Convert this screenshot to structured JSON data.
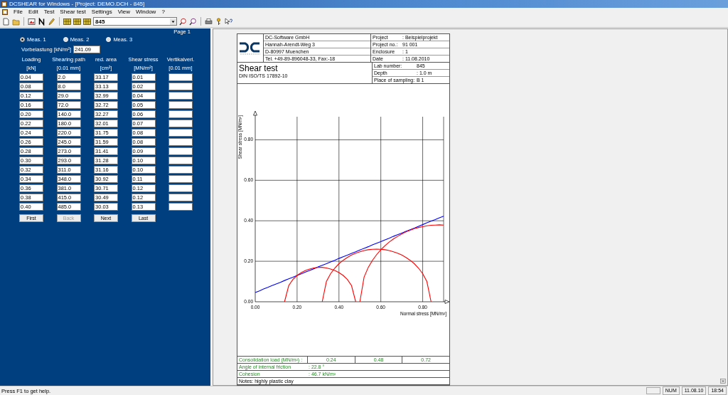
{
  "window": {
    "title": "DCSHEAR for Windows - [Project: DEMO.DCH - 845]"
  },
  "menu": [
    "File",
    "Edit",
    "Test",
    "Shear test",
    "Settings",
    "View",
    "Window",
    "?"
  ],
  "toolbar": {
    "combo_value": "845"
  },
  "input_panel": {
    "page": "Page 1",
    "measurements": [
      {
        "label": "Meas. 1",
        "selected": true
      },
      {
        "label": "Meas. 2",
        "selected": false
      },
      {
        "label": "Meas. 3",
        "selected": false
      }
    ],
    "preload": {
      "label": "Vorbelastung [kN/m²]",
      "value": "241.09"
    },
    "columns": [
      {
        "title": "Loading",
        "unit": "[kN]"
      },
      {
        "title": "Shearing path",
        "unit": "[0.01 mm]"
      },
      {
        "title": "red. area",
        "unit": "[cm²]"
      },
      {
        "title": "Shear stress",
        "unit": "[MN/m²]"
      },
      {
        "title": "Vertikalverl.",
        "unit": "[0.01 mm]"
      }
    ],
    "rows": [
      [
        "0.04",
        "2.0",
        "33.17",
        "0.01"
      ],
      [
        "0.08",
        "8.0",
        "33.13",
        "0.02"
      ],
      [
        "0.12",
        "29.0",
        "32.99",
        "0.04"
      ],
      [
        "0.16",
        "72.0",
        "32.72",
        "0.05"
      ],
      [
        "0.20",
        "140.0",
        "32.27",
        "0.06"
      ],
      [
        "0.22",
        "180.0",
        "32.01",
        "0.07"
      ],
      [
        "0.24",
        "220.0",
        "31.75",
        "0.08"
      ],
      [
        "0.26",
        "245.0",
        "31.59",
        "0.08"
      ],
      [
        "0.28",
        "273.0",
        "31.41",
        "0.09"
      ],
      [
        "0.30",
        "293.0",
        "31.28",
        "0.10"
      ],
      [
        "0.32",
        "311.0",
        "31.16",
        "0.10"
      ],
      [
        "0.34",
        "348.0",
        "30.92",
        "0.11"
      ],
      [
        "0.36",
        "381.0",
        "30.71",
        "0.12"
      ],
      [
        "0.38",
        "415.0",
        "30.49",
        "0.12"
      ],
      [
        "0.40",
        "485.0",
        "30.03",
        "0.13"
      ]
    ],
    "buttons": [
      {
        "label": "First",
        "disabled": false
      },
      {
        "label": "Back",
        "disabled": true
      },
      {
        "label": "Next",
        "disabled": false
      },
      {
        "label": "Last",
        "disabled": false
      }
    ]
  },
  "report": {
    "company": [
      "DC-Software GmbH",
      "Hannah-Arendt-Weg 3",
      "D-80997 Muenchen",
      "Tel. +49-89-896048-33, Fax:-18"
    ],
    "project": [
      {
        "label": "Project",
        "value": ": Beispielprojekt"
      },
      {
        "label": "Project no.:",
        "value": "91 001"
      },
      {
        "label": "Enclosure",
        "value": ": 1"
      },
      {
        "label": "Date",
        "value": ": 11.08.2010"
      }
    ],
    "title": "Shear test",
    "standard": "DIN ISO/TS 17892-10",
    "sample": [
      {
        "label": "Lab number:",
        "value": "845"
      },
      {
        "label": "Depth",
        "value": ": 1.0 m"
      },
      {
        "label": "Place of sampling:",
        "value": "B 1"
      }
    ],
    "chart_data": {
      "type": "line",
      "xlabel": "Normal stress [MN/m²]",
      "ylabel": "Shear stress [MN/m²]",
      "grid": true,
      "x": [
        0,
        0.02,
        0.04,
        0.06,
        0.08,
        0.1,
        0.12,
        0.14,
        0.16,
        0.18,
        0.2,
        0.22,
        0.24,
        0.26,
        0.28,
        0.3,
        0.32,
        0.34,
        0.36,
        0.38,
        0.4,
        0.42,
        0.44,
        0.46,
        0.48,
        0.5,
        0.52,
        0.54,
        0.56,
        0.58,
        0.6,
        0.62,
        0.64,
        0.66,
        0.68,
        0.7,
        0.72,
        0.74,
        0.76,
        0.78,
        0.8,
        0.82,
        0.84,
        0.86,
        0.88,
        0.9
      ],
      "series": [
        {
          "color": "#0000ff",
          "values": [
            0.046,
            0.054,
            0.063,
            0.071,
            0.08,
            0.088,
            0.096,
            0.105,
            0.113,
            0.121,
            0.13,
            0.138,
            0.147,
            0.155,
            0.163,
            0.172,
            0.18,
            0.188,
            0.197,
            0.205,
            0.214,
            0.222,
            0.23,
            0.239,
            0.247,
            0.256,
            0.264,
            0.272,
            0.281,
            0.289,
            0.297,
            0.306,
            0.314,
            0.323,
            0.331,
            0.339,
            0.348,
            0.356,
            0.364,
            0.373,
            0.381,
            0.39,
            0.398,
            0.406,
            0.415,
            0.423
          ]
        },
        {
          "color": "#ff0000",
          "values": [
            null,
            null,
            null,
            null,
            null,
            null,
            null,
            0,
            0.08,
            0.11,
            0.13,
            0.144,
            0.155,
            0.162,
            0.167,
            0.17,
            0.17,
            0.167,
            0.162,
            0.155,
            0.144,
            0.13,
            0.11,
            0.08,
            0,
            null,
            null,
            null,
            null,
            null,
            null,
            null,
            null,
            null,
            null,
            null,
            null,
            null,
            null,
            null,
            null,
            null,
            null,
            null,
            null,
            null
          ]
        },
        {
          "color": "#ff0000",
          "values": [
            null,
            null,
            null,
            null,
            null,
            null,
            null,
            null,
            null,
            null,
            null,
            null,
            null,
            null,
            null,
            null,
            0,
            0.1,
            0.139,
            0.166,
            0.188,
            0.205,
            0.219,
            0.231,
            0.24,
            0.247,
            0.253,
            0.257,
            0.259,
            0.26,
            0.259,
            0.257,
            0.253,
            0.247,
            0.24,
            0.231,
            0.219,
            0.205,
            0.188,
            0.166,
            0.139,
            0.1,
            0,
            null,
            null,
            null
          ]
        },
        {
          "color": "#ff0000",
          "values": [
            null,
            null,
            null,
            null,
            null,
            null,
            null,
            null,
            null,
            null,
            null,
            null,
            null,
            null,
            null,
            null,
            null,
            null,
            null,
            null,
            null,
            null,
            null,
            null,
            null,
            0,
            0.122,
            0.17,
            0.205,
            0.233,
            0.257,
            0.277,
            0.295,
            0.31,
            0.323,
            0.335,
            0.345,
            0.353,
            0.361,
            0.367,
            0.371,
            0.375,
            0.378,
            0.379,
            0.38,
            0.379
          ]
        }
      ],
      "xlim": [
        0,
        0.9
      ],
      "ylim": [
        0,
        0.914
      ],
      "xticks": [
        {
          "value": 0,
          "label": "0.00"
        },
        {
          "value": 0.2,
          "label": "0.20"
        },
        {
          "value": 0.4,
          "label": "0.40"
        },
        {
          "value": 0.6,
          "label": "0.60"
        },
        {
          "value": 0.8,
          "label": "0.80"
        }
      ],
      "yticks": [
        {
          "value": 0,
          "label": "0.00"
        },
        {
          "value": 0.2,
          "label": "0.20"
        },
        {
          "value": 0.4,
          "label": "0.40"
        },
        {
          "value": 0.6,
          "label": "0.60"
        },
        {
          "value": 0.8,
          "label": "0.80"
        }
      ]
    },
    "load_label": "Consolidation load (MN/m²) :",
    "loads": [
      "0.24",
      "0.48",
      "0.72"
    ],
    "results": [
      {
        "label": "Angle of internal friction",
        "value": ": 22.8 °"
      },
      {
        "label": "Cohesion",
        "value": ": 46.7 kN/m²"
      }
    ],
    "notes": "Notes: highly plastic clay"
  },
  "status_bar": {
    "help": "Press F1 to get help.",
    "indicators": [
      "NUM",
      "11.08.10",
      "18:54"
    ]
  }
}
